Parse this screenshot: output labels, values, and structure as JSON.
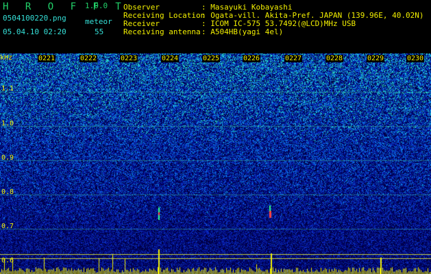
{
  "header": {
    "app_title": "H R O F F T",
    "version": "1.0.0",
    "filename": "0504100220.png",
    "datetime": "05.04.10 02:20",
    "mode_label": "meteor",
    "count": "55"
  },
  "station": {
    "labels": [
      "Observer",
      "Receiving Location",
      "Receiver",
      "Receiving antenna"
    ],
    "values": [
      ": Masayuki Kobayashi",
      ": Ogata-vill. Akita-Pref. JAPAN (139.96E, 40.02N)",
      ": ICOM IC-575 53.7492(@LCD)MHz USB",
      ": A504HB(yagi 4el)"
    ]
  },
  "spectrogram": {
    "y_unit": "kHz",
    "y_ticks": [
      "1.1",
      "1.0",
      "0.9",
      "0.8",
      "0.7",
      "0.6"
    ],
    "x_ticks": [
      "0221",
      "0222",
      "0223",
      "0224",
      "0225",
      "0226",
      "0227",
      "0228",
      "0229",
      "0230"
    ]
  },
  "colors": {
    "background": "#000000",
    "label_green": "#22d36a",
    "label_cyan": "#35e0d8",
    "label_yellow": "#f3f000",
    "spec_dark": "#00045a",
    "spec_mid": "#1040d0",
    "spec_high": "#30e0c0"
  }
}
